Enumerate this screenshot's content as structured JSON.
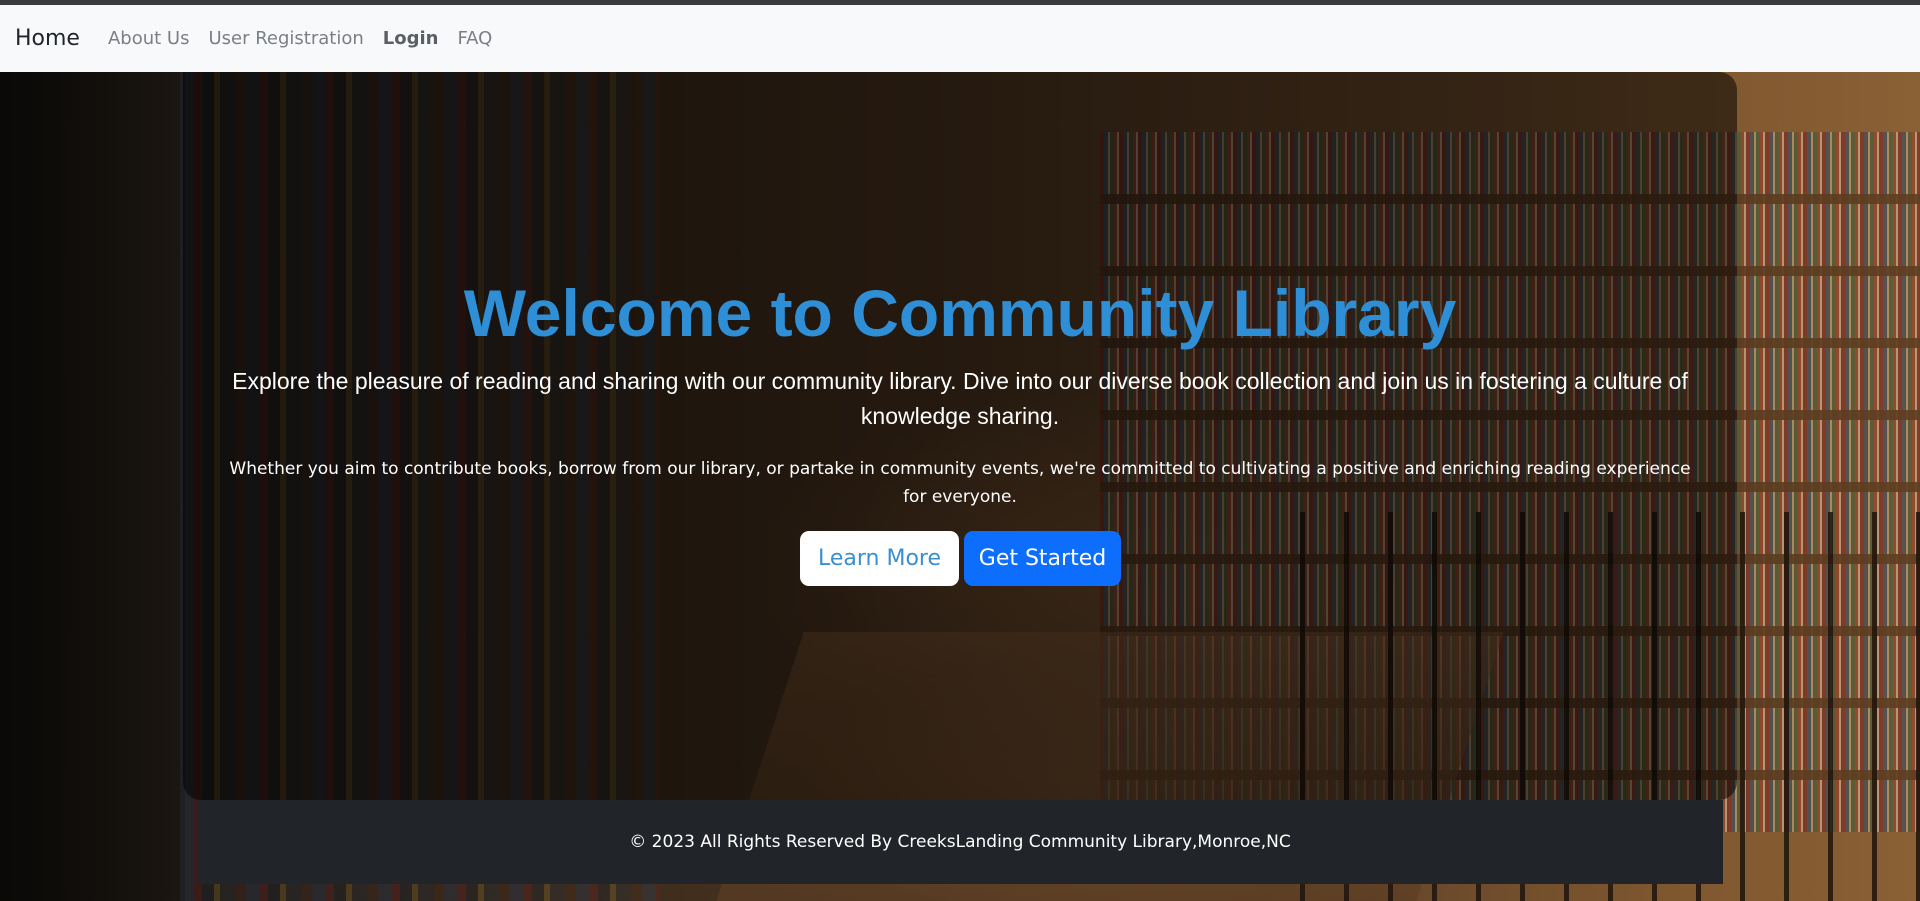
{
  "navbar": {
    "brand": "Home",
    "links": [
      {
        "label": "About Us"
      },
      {
        "label": "User Registration"
      },
      {
        "label": "Login"
      },
      {
        "label": "FAQ"
      }
    ]
  },
  "hero": {
    "title": "Welcome to Community Library",
    "lead": "Explore the pleasure of reading and sharing with our community library. Dive into our diverse book collection and join us in fostering a culture of knowledge sharing.",
    "subtext": "Whether you aim to contribute books, borrow from our library, or partake in community events, we're committed to cultivating a positive and enriching reading experience for everyone.",
    "buttons": {
      "learn_more": "Learn More",
      "get_started": "Get Started"
    }
  },
  "footer": {
    "text": "© 2023 All Rights Reserved By CreeksLanding Community Library,Monroe,NC"
  },
  "colors": {
    "title": "#2f8fd6",
    "primary_button": "#0d6efd",
    "footer_bg": "#212529",
    "navbar_bg": "#f8f9fa"
  }
}
